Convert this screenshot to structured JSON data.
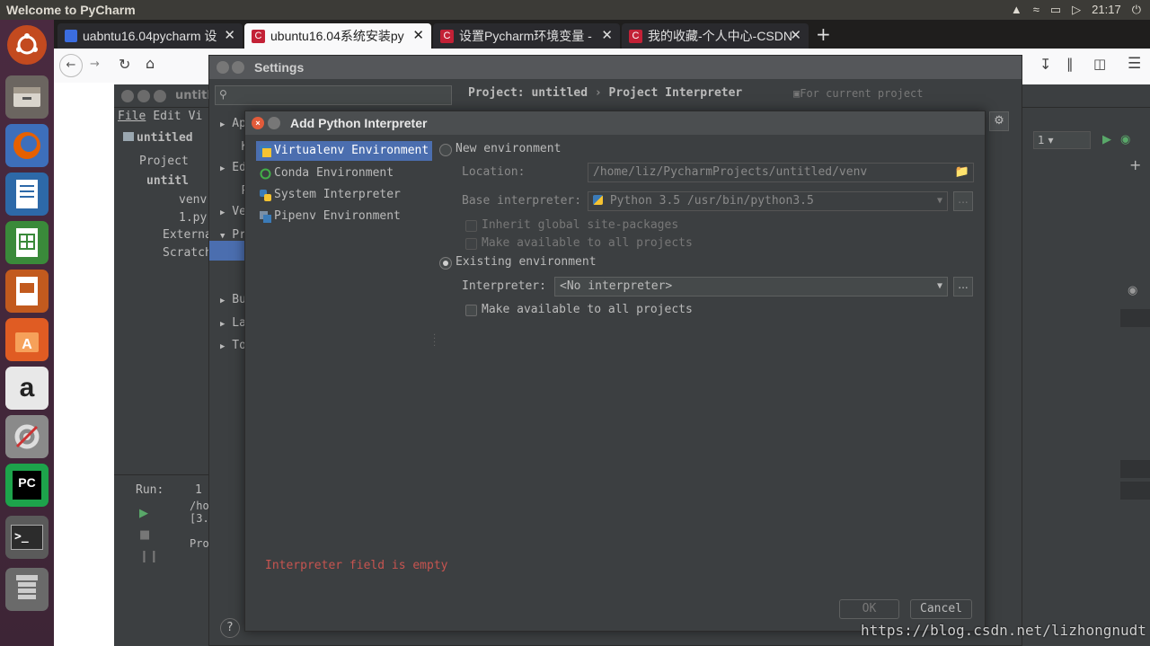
{
  "top_panel": {
    "title": "Welcome to PyCharm",
    "clock": "21:17"
  },
  "browser": {
    "tabs": [
      {
        "label": "uabntu16.04pycharm 设",
        "active": false
      },
      {
        "label": "ubuntu16.04系统安装py",
        "active": true
      },
      {
        "label": "设置Pycharm环境变量 - ",
        "active": false
      },
      {
        "label": "我的收藏-个人中心-CSDN",
        "active": false
      }
    ],
    "new_tab": "+",
    "close": "✕"
  },
  "pycharm": {
    "title": "untitled",
    "menu": [
      "File",
      "Edit",
      "Vi"
    ],
    "breadcrumb": "untitled",
    "project_tool": "Project",
    "tree": [
      {
        "label": "untitl",
        "level": 0
      },
      {
        "label": "venv",
        "level": 1
      },
      {
        "label": "1.py",
        "level": 1
      },
      {
        "label": "Externa",
        "level": 0
      },
      {
        "label": "Scratch",
        "level": 0
      }
    ],
    "run_label": "Run:",
    "run_tab": "1",
    "run_lines": [
      "/ho",
      "[3.",
      "",
      "Pro"
    ],
    "run_config": "1"
  },
  "settings": {
    "title": "Settings",
    "search_placeholder": "",
    "breadcrumb_project": "Project: untitled",
    "breadcrumb_sep": "›",
    "breadcrumb_page": "Project Interpreter",
    "for_current": "For current project",
    "nav_left": [
      "Ap",
      "Ke",
      "Ed",
      "Pl",
      "Ve",
      "Pr",
      "",
      "Bu",
      "La",
      "To"
    ]
  },
  "dialog": {
    "title": "Add Python Interpreter",
    "list": [
      {
        "label": "Virtualenv Environment",
        "selected": true,
        "icon": "virtualenv-icon"
      },
      {
        "label": "Conda Environment",
        "selected": false,
        "icon": "conda-icon"
      },
      {
        "label": "System Interpreter",
        "selected": false,
        "icon": "python-icon"
      },
      {
        "label": "Pipenv Environment",
        "selected": false,
        "icon": "pipenv-icon"
      }
    ],
    "new_env": {
      "label": "New environment",
      "location_label": "Location:",
      "location_value": "/home/liz/PycharmProjects/untitled/venv",
      "base_label": "Base interpreter:",
      "base_value": "Python 3.5 /usr/bin/python3.5",
      "inherit_label": "Inherit global site-packages",
      "make_available_label": "Make available to all projects"
    },
    "existing_env": {
      "label": "Existing environment",
      "interpreter_label": "Interpreter:",
      "interpreter_value": "<No interpreter>",
      "make_available_label": "Make available to all projects"
    },
    "dots": "...",
    "error": "Interpreter field is empty",
    "ok": "OK",
    "cancel": "Cancel"
  },
  "watermark": "https://blog.csdn.net/lizhongnudt",
  "colors": {
    "selection": "#4b6eaf",
    "error": "#c75450",
    "dialog_bg": "#3c3f41",
    "launcher": "#4a2a40"
  }
}
